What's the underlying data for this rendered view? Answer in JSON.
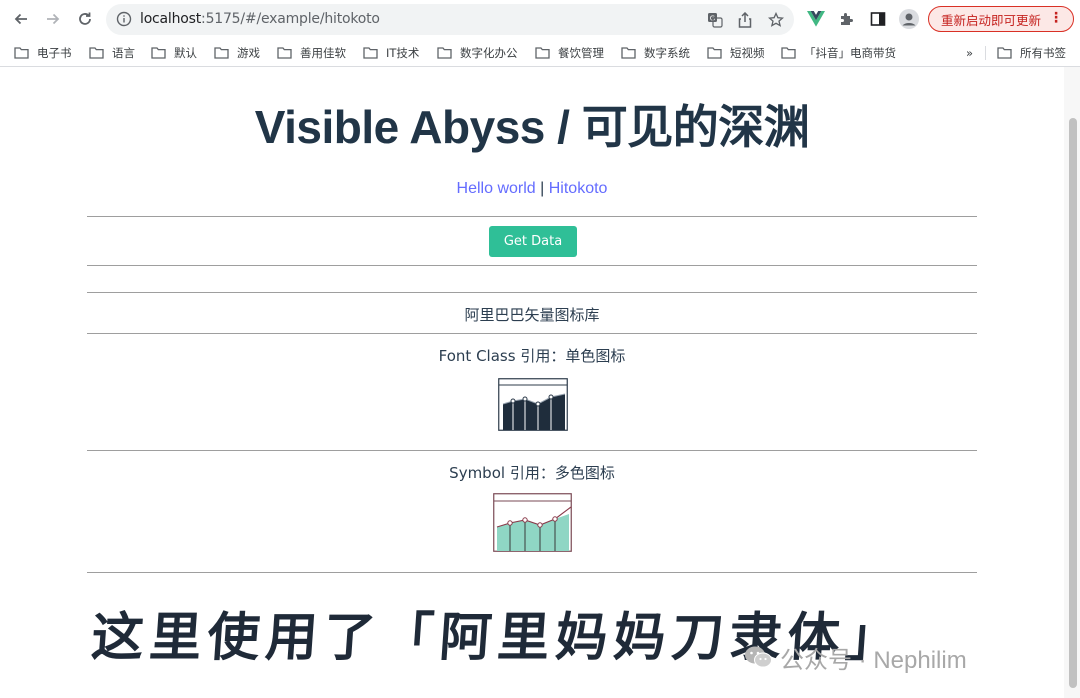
{
  "browser": {
    "url_host": "localhost",
    "url_rest": ":5175/#/example/hitokoto",
    "update_label": "重新启动即可更新",
    "bookmarks": [
      "电子书",
      "语言",
      "默认",
      "游戏",
      "善用佳软",
      "IT技术",
      "数字化办公",
      "餐饮管理",
      "数字系统",
      "短视频",
      "「抖音」电商带货"
    ],
    "overflow": "»",
    "all_bookmarks": "所有书签"
  },
  "icons": {
    "back": "arrow-left-icon",
    "forward": "arrow-right-icon",
    "reload": "reload-icon",
    "info": "info-icon",
    "translate": "translate-icon",
    "share": "share-icon",
    "star": "star-icon",
    "vue": "vue-devtools-icon",
    "extensions": "puzzle-icon",
    "sidepanel": "side-panel-icon",
    "profile": "profile-icon",
    "menu": "kebab-menu-icon",
    "folder": "folder-icon"
  },
  "page": {
    "title": "Visible Abyss / 可见的深渊",
    "links": [
      "Hello world",
      "Hitokoto"
    ],
    "link_separator": "|",
    "get_data_label": "Get Data",
    "iconfont_heading": "阿里巴巴矢量图标库",
    "font_class_label": "Font Class 引用：单色图标",
    "symbol_label": "Symbol 引用：多色图标",
    "caption": "这里使用了「阿里妈妈刀隶体」",
    "watermark": "公众号 · Nephilim"
  },
  "colors": {
    "accent_link": "#646cff",
    "button": "#2fbf97",
    "title": "#213547",
    "update_border": "#d93025",
    "symbol_fill": "#8fd6c4"
  }
}
